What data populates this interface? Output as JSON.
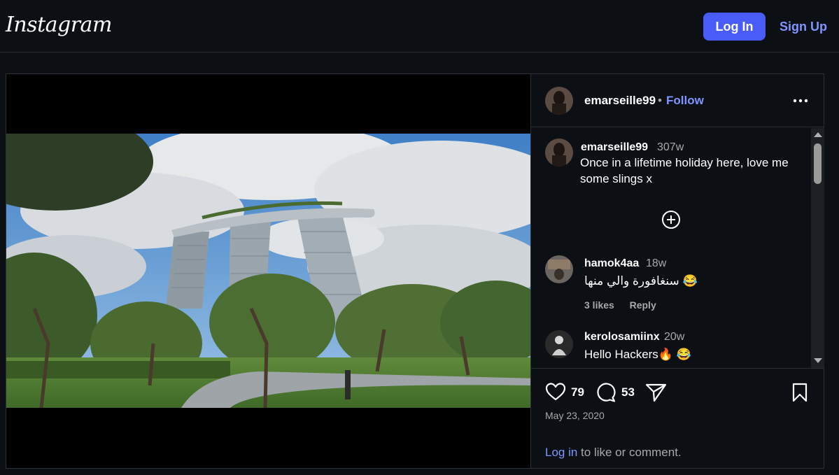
{
  "header": {
    "logo": "Instagram",
    "login_label": "Log In",
    "signup_label": "Sign Up"
  },
  "post": {
    "author": "emarseille99",
    "separator": "•",
    "follow_label": "Follow",
    "caption": {
      "user": "emarseille99",
      "time": "307w",
      "text": "Once in a lifetime holiday here, love me some slings x"
    },
    "comments": [
      {
        "user": "hamok4aa",
        "time": "18w",
        "text": "سنغافورة والي منها 😂",
        "likes": "3 likes",
        "reply": "Reply"
      },
      {
        "user": "kerolosamiinx",
        "time": "20w",
        "text": "Hello Hackers🔥 😂"
      }
    ],
    "likes_count": "79",
    "comments_count": "53",
    "date": "May 23, 2020",
    "login_prompt": {
      "link": "Log in",
      "rest": " to like or comment."
    }
  },
  "icons": {
    "more": "more-options-icon",
    "load_more": "plus-circle-icon",
    "like": "heart-icon",
    "comment": "comment-bubble-icon",
    "share": "send-icon",
    "save": "bookmark-icon"
  },
  "colors": {
    "accent": "#4a5cf7",
    "link": "#7e96ff",
    "background": "#0c0f14",
    "muted": "#a8a8a8"
  }
}
